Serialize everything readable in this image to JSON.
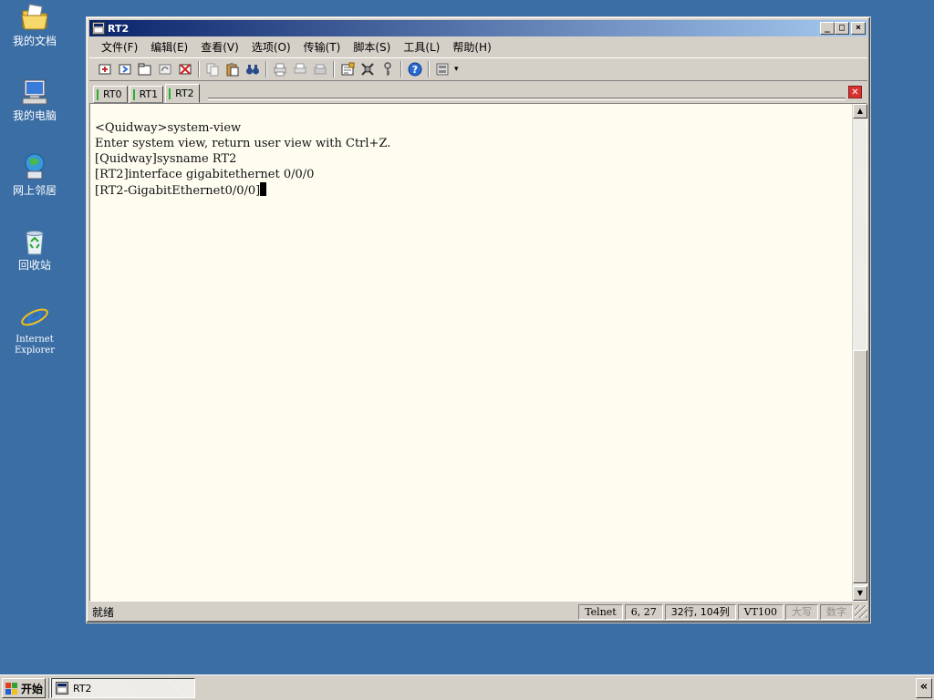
{
  "desktop": {
    "icons": [
      {
        "label": "我的文档",
        "icon": "my-documents-icon"
      },
      {
        "label": "我的电脑",
        "icon": "my-computer-icon"
      },
      {
        "label": "网上邻居",
        "icon": "network-places-icon"
      },
      {
        "label": "回收站",
        "icon": "recycle-bin-icon"
      },
      {
        "label": "Internet Explorer",
        "icon": "internet-explorer-icon"
      }
    ]
  },
  "window": {
    "title": "RT2",
    "menu": [
      "文件(F)",
      "编辑(E)",
      "查看(V)",
      "选项(O)",
      "传输(T)",
      "脚本(S)",
      "工具(L)",
      "帮助(H)"
    ],
    "tabs": [
      {
        "label": "RT0",
        "active": false
      },
      {
        "label": "RT1",
        "active": false
      },
      {
        "label": "RT2",
        "active": true
      }
    ],
    "terminal_lines": [
      "<Quidway>system-view",
      "Enter system view, return user view with Ctrl+Z.",
      "[Quidway]sysname RT2",
      "[RT2]interface gigabitethernet 0/0/0",
      "[RT2-GigabitEthernet0/0/0]"
    ],
    "status": {
      "main": "就绪",
      "protocol": "Telnet",
      "cursor_pos": "6,  27",
      "size": "32行, 104列",
      "emulation": "VT100",
      "caps": "大写",
      "num": "数字"
    }
  },
  "taskbar": {
    "start_label": "开始",
    "task_label": "RT2"
  },
  "colors": {
    "desktop": "#3a6ea5",
    "terminal_bg": "#fffcf0",
    "title_start": "#0a246a",
    "title_end": "#a6caf0",
    "tab_mark": "#2cb02c"
  }
}
